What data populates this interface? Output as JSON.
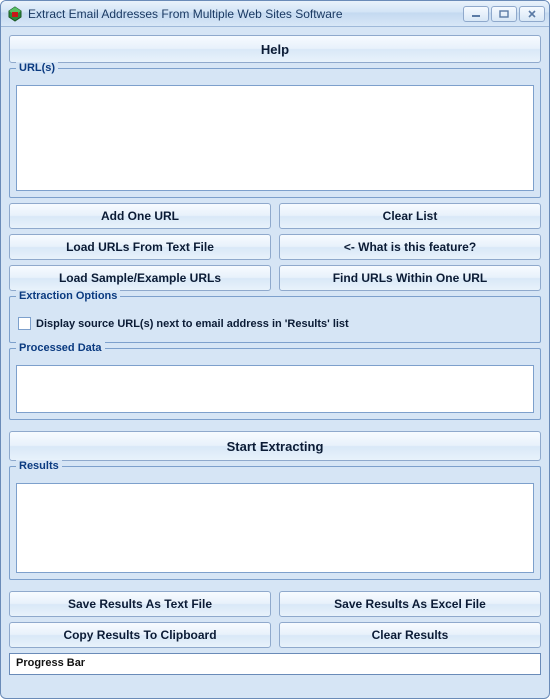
{
  "window": {
    "title": "Extract Email Addresses From Multiple Web Sites Software"
  },
  "help": {
    "label": "Help"
  },
  "urls": {
    "legend": "URL(s)"
  },
  "buttons": {
    "add_one_url": "Add One URL",
    "clear_list": "Clear List",
    "load_from_file": "Load URLs From Text File",
    "what_is_this": "<- What is this feature?",
    "load_sample": "Load Sample/Example URLs",
    "find_within": "Find URLs Within One URL",
    "start": "Start Extracting",
    "save_text": "Save Results As Text File",
    "save_excel": "Save Results As Excel File",
    "copy_clipboard": "Copy Results To Clipboard",
    "clear_results": "Clear Results"
  },
  "options": {
    "legend": "Extraction Options",
    "display_source_label": "Display source URL(s) next to email address in 'Results' list"
  },
  "processed": {
    "legend": "Processed Data"
  },
  "results": {
    "legend": "Results"
  },
  "progress": {
    "label": "Progress Bar"
  }
}
